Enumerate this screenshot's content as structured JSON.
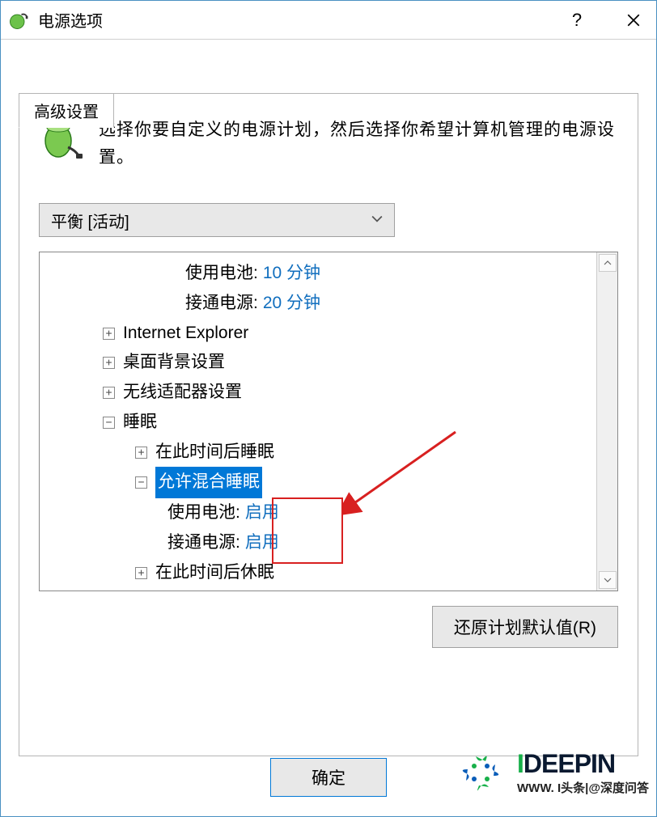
{
  "window": {
    "title": "电源选项"
  },
  "tab": {
    "label": "高级设置"
  },
  "description": "选择你要自定义的电源计划，然后选择你希望计算机管理的电源设置。",
  "plan_select": {
    "selected": "平衡 [活动]"
  },
  "tree": {
    "battery_label": "使用电池:",
    "battery_value": "10 分钟",
    "plugged_label": "接通电源:",
    "plugged_value": "20 分钟",
    "ie_label": "Internet Explorer",
    "desktop_bg_label": "桌面背景设置",
    "wireless_label": "无线适配器设置",
    "sleep_label": "睡眠",
    "sleep_after_label": "在此时间后睡眠",
    "hybrid_sleep_label": "允许混合睡眠",
    "hybrid_battery_label": "使用电池:",
    "hybrid_battery_value": "启用",
    "hybrid_plugged_label": "接通电源:",
    "hybrid_plugged_value": "启用",
    "hibernate_after_label": "在此时间后休眠"
  },
  "buttons": {
    "restore": "还原计划默认值(R)",
    "ok": "确定"
  },
  "watermark": {
    "brand_i": "I",
    "brand_rest": "DEEPIN",
    "sub": "WWW. I头条|@深度问答"
  }
}
